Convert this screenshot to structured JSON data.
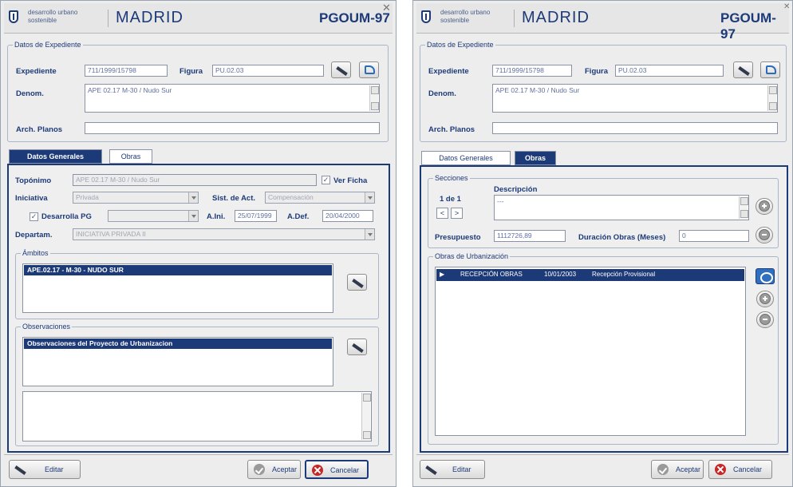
{
  "header": {
    "subtitle": "desarrollo urbano sostenible",
    "city": "MADRID",
    "plan": "PGOUM-97",
    "close": "✕"
  },
  "expediente": {
    "group": "Datos de Expediente",
    "expediente_label": "Expediente",
    "expediente_value": "711/1999/15798",
    "figura_label": "Figura",
    "figura_value": "PU.02.03",
    "denom_label": "Denom.",
    "denom_value": "APE 02.17 M-30 / Nudo Sur",
    "planos_label": "Arch. Planos",
    "planos_value": ""
  },
  "tabs": [
    "Datos Generales",
    "Obras"
  ],
  "generales": {
    "toponimo_label": "Topónimo",
    "toponimo_value": "APE 02.17 M-30 / Nudo Sur",
    "ver_ficha": "Ver Ficha",
    "iniciativa_label": "Iniciativa",
    "iniciativa_value": "Privada",
    "sist_label": "Sist. de Act.",
    "sist_value": "Compensación",
    "desarrolla_label": "Desarrolla PG",
    "desarrolla_value": "",
    "aini_label": "A.Ini.",
    "aini_value": "25/07/1999",
    "adef_label": "A.Def.",
    "adef_value": "20/04/2000",
    "departam_label": "Departam.",
    "departam_value": "INICIATIVA PRIVADA II",
    "ambitos_group": "Ámbitos",
    "ambitos_item": "APE.02.17 - M-30 - NUDO SUR",
    "observ_group": "Observaciones",
    "observ_item": "Observaciones del Proyecto de Urbanizacion"
  },
  "obras": {
    "secciones_group": "Secciones",
    "counter": "1 de 1",
    "prev": "<",
    "next": ">",
    "descripcion_label": "Descripción",
    "descripcion_value": "---",
    "presupuesto_label": "Presupuesto",
    "presupuesto_value": "1112726,89",
    "duracion_label": "Duración Obras (Meses)",
    "duracion_value": "0",
    "urb_group": "Obras de Urbanización",
    "row": {
      "marker": "▶",
      "name": "RECEPCIÓN OBRAS",
      "date": "10/01/2003",
      "type": "Recepción Provisional"
    }
  },
  "footer": {
    "edit": "Editar",
    "accept": "Aceptar",
    "cancel": "Cancelar"
  },
  "colors": {
    "accent": "#1d3a78",
    "cancel": "#c62828"
  }
}
